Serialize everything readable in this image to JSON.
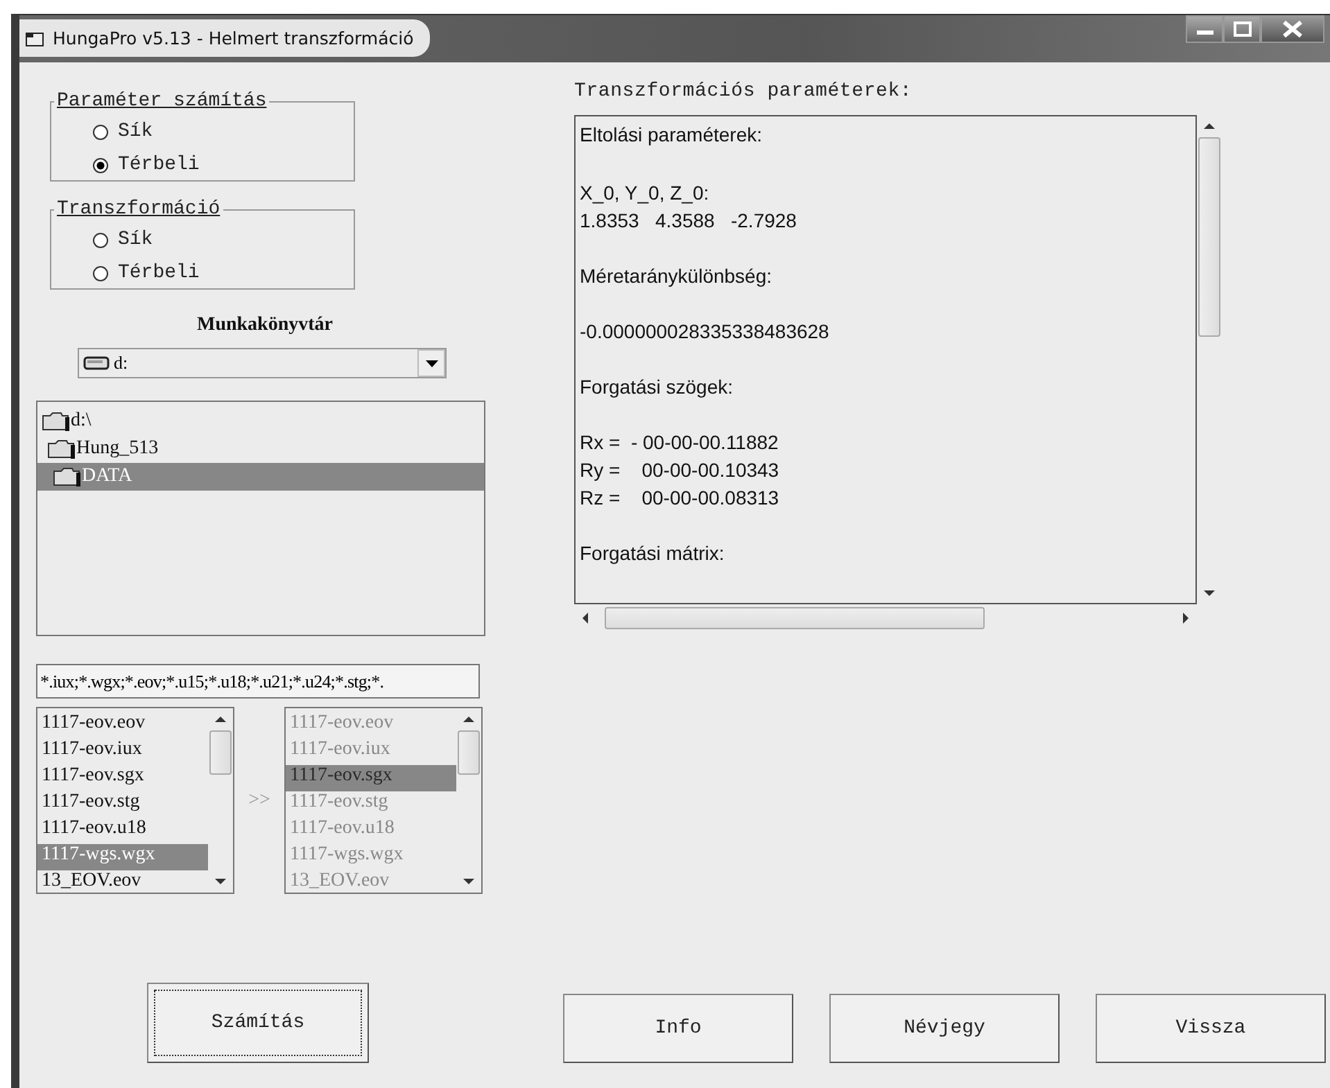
{
  "window": {
    "title": "HungaPro v5.13 - Helmert transzformáció"
  },
  "groups": [
    {
      "title": "Paraméter számítás",
      "options": [
        {
          "label": "Sík",
          "selected": false
        },
        {
          "label": "Térbeli",
          "selected": true
        }
      ]
    },
    {
      "title": "Transzformáció",
      "options": [
        {
          "label": "Sík",
          "selected": false
        },
        {
          "label": "Térbeli",
          "selected": false
        }
      ]
    }
  ],
  "workdir": {
    "label": "Munkakönyvtár",
    "drive": "d:",
    "folders": [
      {
        "name": "d:\\",
        "selected": false,
        "children": [
          {
            "name": "Hung_513",
            "selected": false,
            "children": [
              {
                "name": "DATA",
                "selected": true
              }
            ]
          }
        ]
      }
    ]
  },
  "filter": {
    "value": "*.iux;*.wgx;*.eov;*.u15;*.u18;*.u21;*.u24;*.stg;*."
  },
  "source_files": {
    "disabled": false,
    "items": [
      {
        "name": "1117-eov.eov",
        "selected": false
      },
      {
        "name": "1117-eov.iux",
        "selected": false
      },
      {
        "name": "1117-eov.sgx",
        "selected": false
      },
      {
        "name": "1117-eov.stg",
        "selected": false
      },
      {
        "name": "1117-eov.u18",
        "selected": false
      },
      {
        "name": "1117-wgs.wgx",
        "selected": true
      },
      {
        "name": "13_EOV.eov",
        "selected": false
      }
    ]
  },
  "move_label": ">>",
  "target_files": {
    "disabled": true,
    "items": [
      {
        "name": "1117-eov.eov",
        "selected": false
      },
      {
        "name": "1117-eov.iux",
        "selected": false
      },
      {
        "name": "1117-eov.sgx",
        "selected": true
      },
      {
        "name": "1117-eov.stg",
        "selected": false
      },
      {
        "name": "1117-eov.u18",
        "selected": false
      },
      {
        "name": "1117-wgs.wgx",
        "selected": false
      },
      {
        "name": "13_EOV.eov",
        "selected": false
      }
    ]
  },
  "compute_button": "Számítás",
  "results": {
    "label": "Transzformációs paraméterek:",
    "blocks": [
      [
        "Eltolási paraméterek:"
      ],
      [
        "X_0, Y_0, Z_0:",
        "1.8353   4.3588   -2.7928"
      ],
      [
        "Méretaránykülönbség:"
      ],
      [
        "-0.000000028335338483628"
      ],
      [
        "Forgatási szögek:"
      ],
      [
        "Rx =  - 00-00-00.11882",
        "Ry =    00-00-00.10343",
        "Rz =    00-00-00.08313"
      ],
      [
        "Forgatási mátrix:"
      ]
    ]
  },
  "buttons": [
    "Info",
    "Névjegy",
    "Vissza"
  ]
}
